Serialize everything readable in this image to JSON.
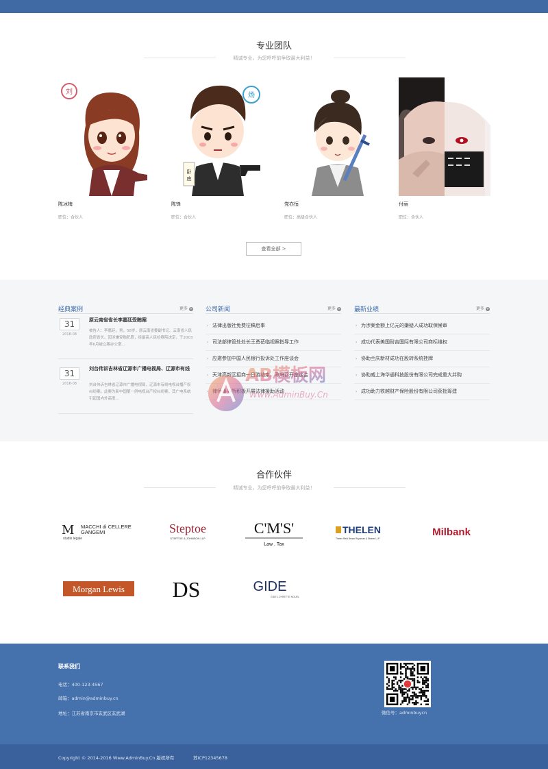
{
  "team": {
    "title": "专业团队",
    "subtitle": "精诚专业，为您呼呼前争取最大利益！",
    "members": [
      {
        "name": "陈冰梅",
        "role": "职位：合伙人"
      },
      {
        "name": "陈锋",
        "role": "职位：合伙人"
      },
      {
        "name": "党亦恒",
        "role": "职位：高级合伙人"
      },
      {
        "name": "付丽",
        "role": "职位：合伙人"
      }
    ],
    "view_all": "查看全部 >"
  },
  "cases": {
    "title": "经典案例",
    "more": "更多",
    "items": [
      {
        "day": "31",
        "ym": "2016-08",
        "title": "原云南省省长李嘉廷受贿案",
        "desc": "被告人：李嘉廷，男，58岁，原云南省委副书记、云南省人民政府省长。因涉嫌受贿犯罪，经最高人民检察院决定，于2003年6月被立案办公室..."
      },
      {
        "day": "31",
        "ym": "2016-08",
        "title": "刘台伟诉吉林省辽源市广播电视局、辽源市有线",
        "desc": "刘台伟诉吉林省辽源市广播电视局、辽源市有线电视台播产权纠纷案。此案为新中国第一例电视台产权纠纷案，其广电系统引起国内外高度..."
      }
    ]
  },
  "news": {
    "title": "公司新闻",
    "more": "更多",
    "items": [
      "法律出版社免费征稿启事",
      "司法部律管处处长王勇莅临视察指导工作",
      "应邀参加中国人民银行投诉处工作座谈会",
      "天津高新区招商一日游结束，政府召开座谈会",
      "律师事务所积极开展法律援助活动"
    ]
  },
  "performance": {
    "title": "最新业绩",
    "more": "更多",
    "items": [
      "为涉案金额上亿元的嫌疑人成功取保候审",
      "成功代表美国耐吉国际有限公司商标维权",
      "协助兰庆新材成功在股转系统挂牌",
      "协助威上海华通科技股份有限公司完成重大并购",
      "成功助力铁越财产保险股份有限公司获批筹建"
    ]
  },
  "watermark": {
    "brand": "AB模板网",
    "url": "Www.AdminBuy.Cn"
  },
  "partners": {
    "title": "合作伙伴",
    "subtitle": "精诚专业，为您呼呼前争取最大利益！",
    "logos": {
      "macchi_line1": "MACCHI di CELLERE",
      "macchi_line2": "GANGEMI",
      "macchi_line3": "studio legale",
      "steptoe": "Steptoe",
      "steptoe_sub": "STEPTOE & JOHNSON LLP",
      "cms": "C'M'S'",
      "cms_sub": "Law . Tax",
      "thelen": "THELEN",
      "thelen_sub": "Thelen Reid Brown Raysman & Steiner LLP",
      "milbank": "Milbank",
      "morgan": "Morgan Lewis",
      "ds": "DS",
      "gide": "GIDE",
      "gide_sub": "GIDE LOYRETTE NOUEL"
    }
  },
  "footer": {
    "title": "联系我们",
    "phone": "电话：400-123-4567",
    "email": "邮箱：admin@adminbuy.cn",
    "address": "地址：江苏省南京市玄武区玄武湖",
    "qr_caption": "微信号：adminbuycn",
    "copyright": "Copyright © 2014-2016 Www.AdminBuy.Cn 版权所有",
    "icp": "苏ICP12345678"
  },
  "colors": {
    "brand": "#4571ad",
    "accent": "#3a6aaa",
    "band": "#f5f6f8"
  }
}
